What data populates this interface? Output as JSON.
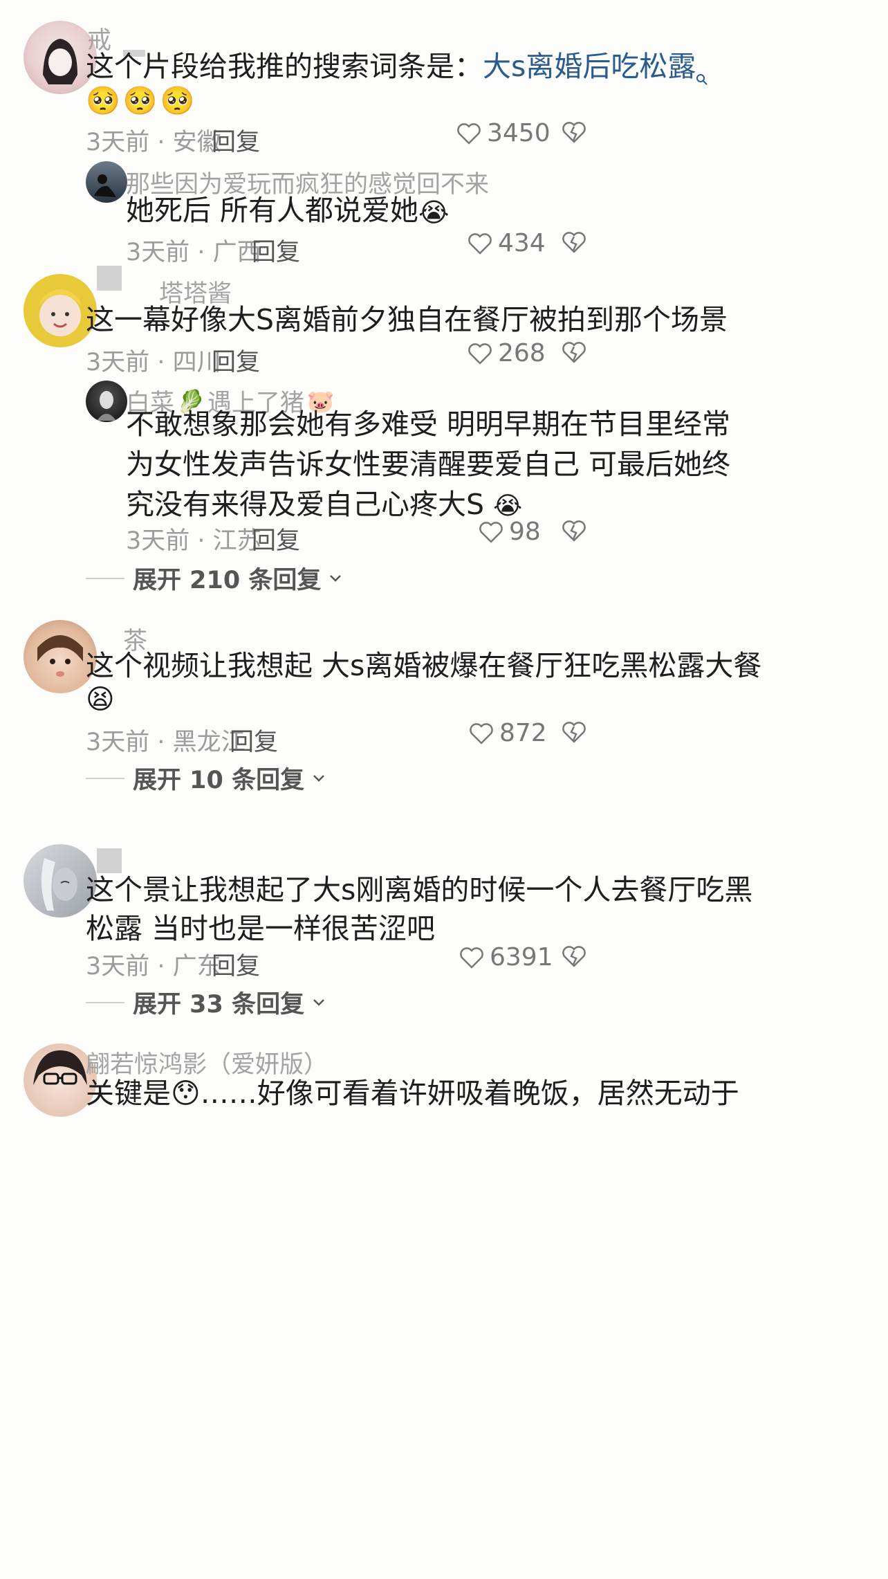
{
  "comments": [
    {
      "username": "戒",
      "text_prefix": "这个片段给我推的搜索词条是：",
      "search_link": "大s离婚后吃松露",
      "emojis": [
        "🥺",
        "🥺",
        "🥺"
      ],
      "time_location": "3天前 · 安徽",
      "reply_label": "回复",
      "likes": "3450",
      "replies": [
        {
          "username": "那些因为爱玩而疯狂的感觉回不来",
          "text": "她死后 所有人都说爱她",
          "emoji": "😭",
          "time_location": "3天前 · 广西",
          "reply_label": "回复",
          "likes": "434"
        }
      ]
    },
    {
      "username": "塔塔酱",
      "text": "这一幕好像大S离婚前夕独自在餐厅被拍到那个场景",
      "time_location": "3天前 · 四川",
      "reply_label": "回复",
      "likes": "268",
      "replies": [
        {
          "username_a": "白菜",
          "username_b": "遇上了猪",
          "lines": [
            "不敢想象那会她有多难受 明明早期在节目里经常",
            "为女性发声告诉女性要清醒要爱自己 可最后她终",
            "究没有来得及爱自己心疼大S"
          ],
          "emoji": "😭",
          "time_location": "3天前 · 江苏",
          "reply_label": "回复",
          "likes": "98"
        }
      ],
      "expand_label": "展开 210 条回复"
    },
    {
      "username": "茶",
      "text": "这个视频让我想起 大s离婚被爆在餐厅狂吃黑松露大餐",
      "emoji": "😫",
      "time_location": "3天前 · 黑龙江",
      "reply_label": "回复",
      "likes": "872",
      "expand_label": "展开 10 条回复"
    },
    {
      "username": "",
      "lines": [
        "这个景让我想起了大s刚离婚的时候一个人去餐厅吃黑",
        "松露 当时也是一样很苦涩吧"
      ],
      "time_location": "3天前 · 广东",
      "reply_label": "回复",
      "likes": "6391",
      "expand_label": "展开 33 条回复"
    },
    {
      "username": "翩若惊鸿影（爱妍版）",
      "text": "关键是😯……好像可看着许妍吸着晚饭，居然无动于"
    }
  ],
  "colors": {
    "link": "#2b5a8c",
    "meta": "#9b9b9b",
    "background": "#fdfdfc"
  }
}
